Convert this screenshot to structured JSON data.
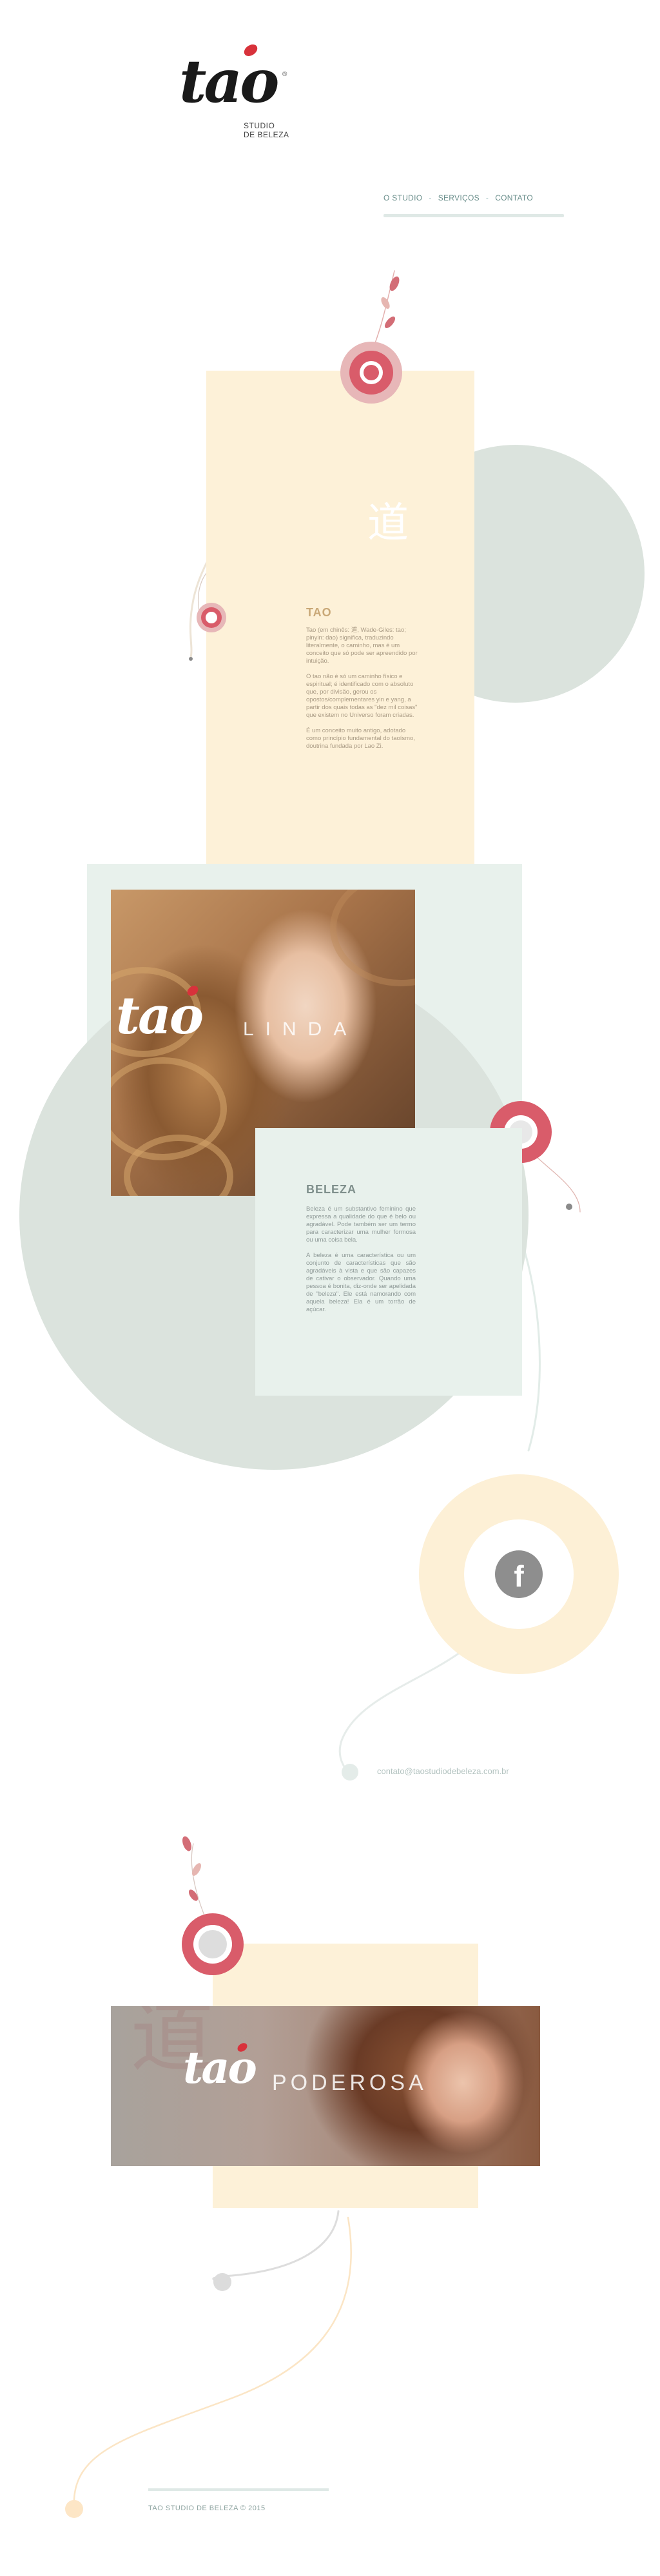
{
  "brand": {
    "logo_word": "tao",
    "logo_sub_line1": "STUDIO",
    "logo_sub_line2": "DE BELEZA",
    "reg_mark": "®"
  },
  "nav": {
    "items": [
      "O STUDIO",
      "SERVIÇOS",
      "CONTATO"
    ],
    "separator": "-"
  },
  "tao_section": {
    "kanji": "道",
    "title": "TAO",
    "paragraphs": [
      "Tao (em chinês: 道, Wade-Giles: tao; pinyin: dao) significa, traduzindo literalmente, o caminho, mas é um conceito que só pode ser apreendido por intuição.",
      "O tao não é só um caminho físico e espiritual; é identificado com o absoluto que, por divisão, gerou os opostos/complementares yin e yang, a partir dos quais todas as \"dez mil coisas\" que existem no Universo foram criadas.",
      "É um conceito muito antigo, adotado como princípio fundamental do taoísmo, doutrina fundada por Lao Zi."
    ]
  },
  "linda_section": {
    "photo_word": "LINDA",
    "title": "BELEZA",
    "paragraphs": [
      "Beleza é um substantivo feminino que expressa a qualidade do que é belo ou agradável. Pode também ser um termo para caracterizar uma mulher formosa ou uma coisa bela.",
      "A beleza é uma característica ou um conjunto de características que são agradáveis à vista e que são capazes de cativar o observador. Quando uma pessoa é bonita, diz-onde ser apelidada de \"beleza\". Ele está namorando com aquela beleza! Ela é um torrão de açúcar."
    ]
  },
  "social": {
    "facebook_glyph": "f",
    "email": "contato@taostudiodebeleza.com.br"
  },
  "poderosa_section": {
    "photo_word": "PODEROSA",
    "watermark": "道"
  },
  "footer": {
    "copyright": "TAO STUDIO DE BELEZA © 2015"
  },
  "colors": {
    "accent_red": "#d8323b",
    "ornament_pink": "#d95c6a",
    "cream": "#fdf1d8",
    "sage": "#dbe3dd",
    "mint": "#e8f1ec"
  }
}
